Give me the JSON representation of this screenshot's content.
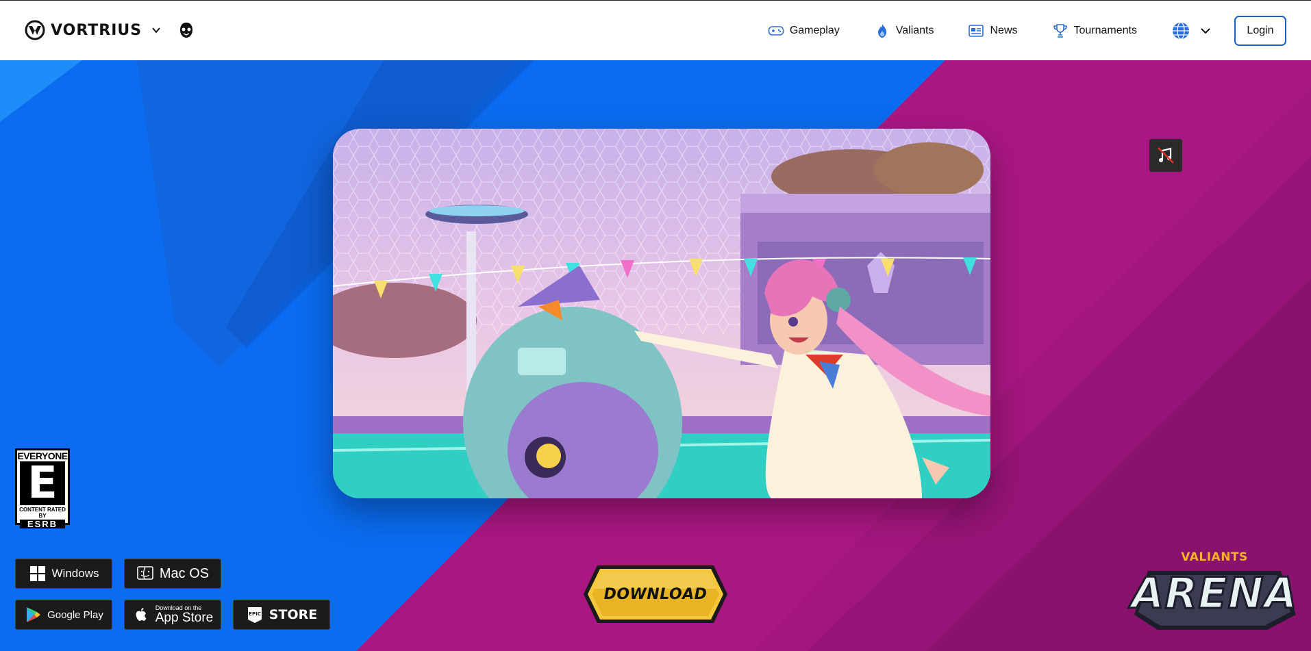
{
  "header": {
    "brand_name": "VORTRIUS",
    "brand_icon": "vortrius-logo-icon",
    "nav": [
      {
        "label": "Gameplay",
        "icon": "gamepad-icon"
      },
      {
        "label": "Valiants",
        "icon": "flame-icon"
      },
      {
        "label": "News",
        "icon": "newspaper-icon"
      },
      {
        "label": "Tournaments",
        "icon": "trophy-icon"
      }
    ],
    "login_label": "Login"
  },
  "esrb": {
    "rating_top": "EVERYONE",
    "rating_letter": "E",
    "content_line": "CONTENT RATED BY",
    "esrb_line": "ESRB"
  },
  "platforms": {
    "windows_label": "Windows",
    "macos_label": "Mac OS",
    "google_play_label": "Google Play",
    "app_store_small": "Download on the",
    "app_store_label": "App Store",
    "epic_label": "STORE",
    "epic_badge": "EPIC"
  },
  "download_label": "DOWNLOAD",
  "game_logo": {
    "top": "VALIANTS",
    "main": "ARENA"
  },
  "colors": {
    "blue": "#0a6ef0",
    "magenta": "#a3167e",
    "login_border": "#1e5fc4",
    "download_gold": "#f2c230"
  }
}
